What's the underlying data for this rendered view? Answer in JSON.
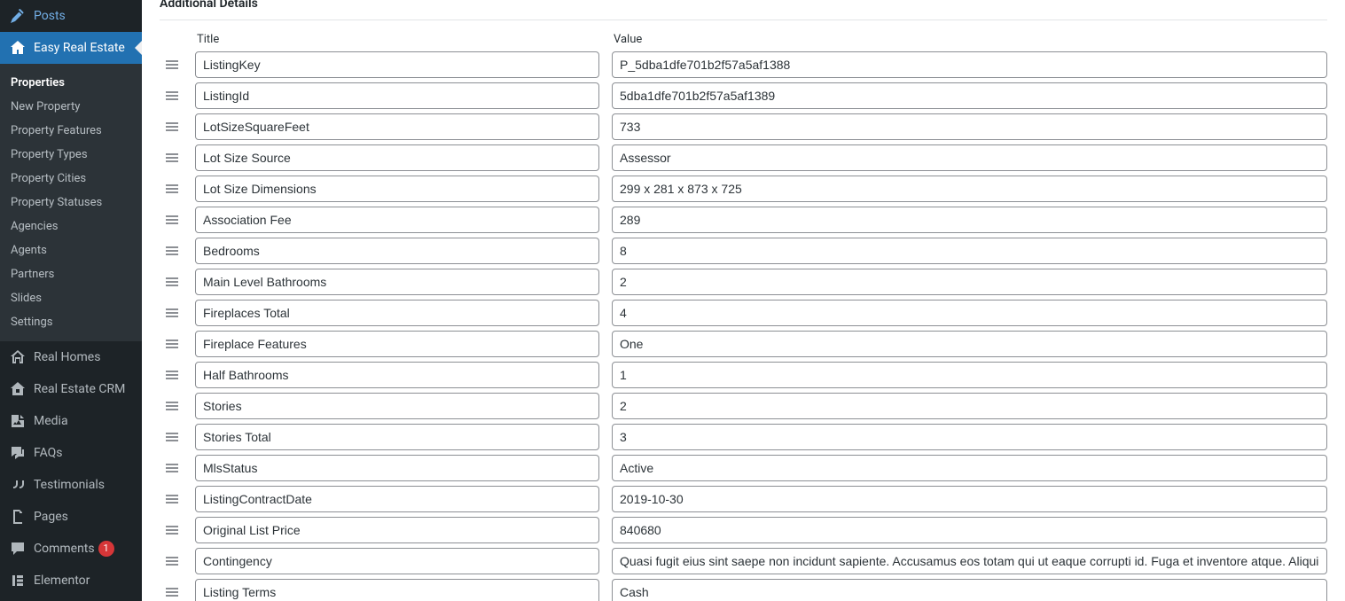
{
  "sidebar": {
    "posts": "Posts",
    "easy_real_estate": "Easy Real Estate",
    "submenu": {
      "properties": "Properties",
      "new_property": "New Property",
      "property_features": "Property Features",
      "property_types": "Property Types",
      "property_cities": "Property Cities",
      "property_statuses": "Property Statuses",
      "agencies": "Agencies",
      "agents": "Agents",
      "partners": "Partners",
      "slides": "Slides",
      "settings": "Settings"
    },
    "real_homes": "Real Homes",
    "real_estate_crm": "Real Estate CRM",
    "media": "Media",
    "faqs": "FAQs",
    "testimonials": "Testimonials",
    "pages": "Pages",
    "comments": "Comments",
    "comments_badge": "1",
    "elementor": "Elementor"
  },
  "panel": {
    "title": "Additional Details",
    "header_title": "Title",
    "header_value": "Value",
    "rows": [
      {
        "title": "ListingKey",
        "value": "P_5dba1dfe701b2f57a5af1388"
      },
      {
        "title": "ListingId",
        "value": "5dba1dfe701b2f57a5af1389"
      },
      {
        "title": "LotSizeSquareFeet",
        "value": "733"
      },
      {
        "title": "Lot Size Source",
        "value": "Assessor"
      },
      {
        "title": "Lot Size Dimensions",
        "value": "299 x 281 x 873 x 725"
      },
      {
        "title": "Association Fee",
        "value": "289"
      },
      {
        "title": "Bedrooms",
        "value": "8"
      },
      {
        "title": "Main Level Bathrooms",
        "value": "2"
      },
      {
        "title": "Fireplaces Total",
        "value": "4"
      },
      {
        "title": "Fireplace Features",
        "value": "One"
      },
      {
        "title": "Half Bathrooms",
        "value": "1"
      },
      {
        "title": "Stories",
        "value": "2"
      },
      {
        "title": "Stories Total",
        "value": "3"
      },
      {
        "title": "MlsStatus",
        "value": "Active"
      },
      {
        "title": "ListingContractDate",
        "value": "2019-10-30"
      },
      {
        "title": "Original List Price",
        "value": "840680"
      },
      {
        "title": "Contingency",
        "value": "Quasi fugit eius sint saepe non incidunt sapiente. Accusamus eos totam qui ut eaque corrupti id. Fuga et inventore atque. Aliquid"
      },
      {
        "title": "Listing Terms",
        "value": "Cash"
      }
    ]
  }
}
